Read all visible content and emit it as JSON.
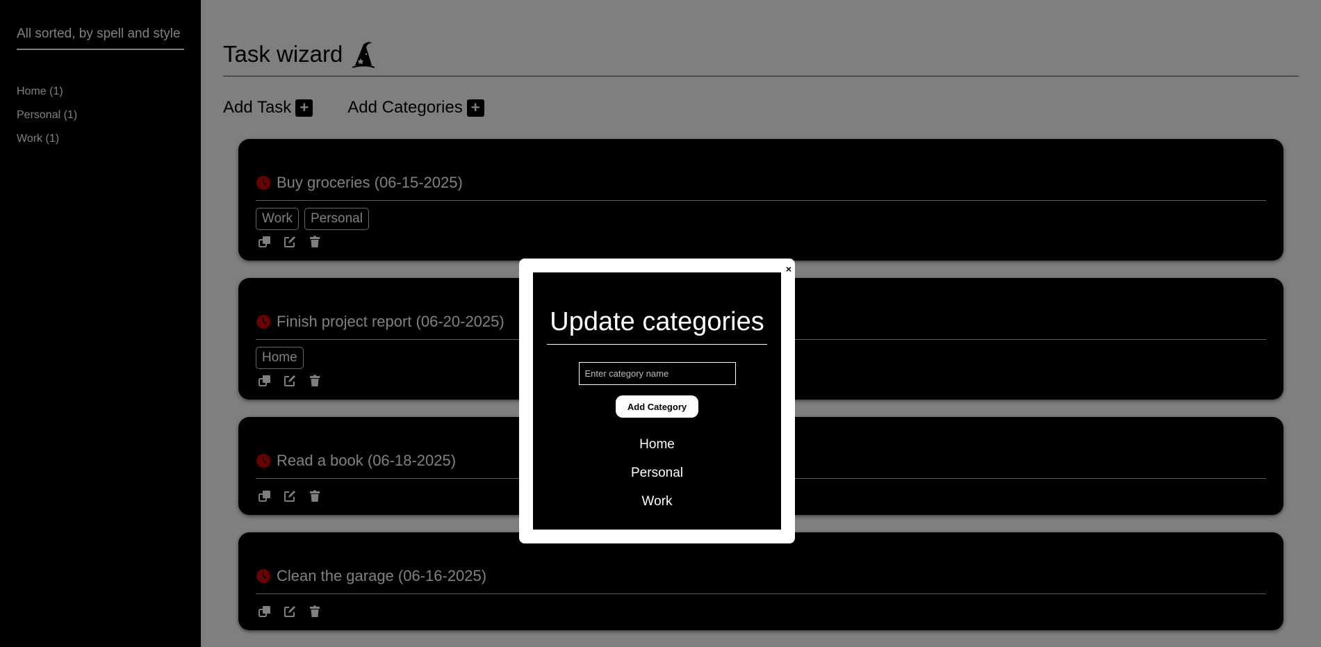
{
  "sidebar": {
    "title": "All sorted, by spell and style",
    "items": [
      {
        "label": "Home (1)"
      },
      {
        "label": "Personal (1)"
      },
      {
        "label": "Work (1)"
      }
    ]
  },
  "header": {
    "title": "Task wizard",
    "icon": "wizard-hat-icon"
  },
  "actions": {
    "add_task": "Add Task",
    "add_categories": "Add Categories"
  },
  "tasks": [
    {
      "title": "Buy groceries (06-15-2025)",
      "tags": [
        "Work",
        "Personal"
      ]
    },
    {
      "title": "Finish project report (06-20-2025)",
      "tags": [
        "Home"
      ]
    },
    {
      "title": "Read a book (06-18-2025)",
      "tags": []
    },
    {
      "title": "Clean the garage (06-16-2025)",
      "tags": []
    }
  ],
  "modal": {
    "close": "×",
    "title": "Update categories",
    "input_placeholder": "Enter category name",
    "input_value": "",
    "button": "Add Category",
    "categories": [
      "Home",
      "Personal",
      "Work"
    ]
  },
  "colors": {
    "clock": "#d40000",
    "card_bg": "#000000",
    "overlay": "rgba(0,0,0,0.5)"
  }
}
